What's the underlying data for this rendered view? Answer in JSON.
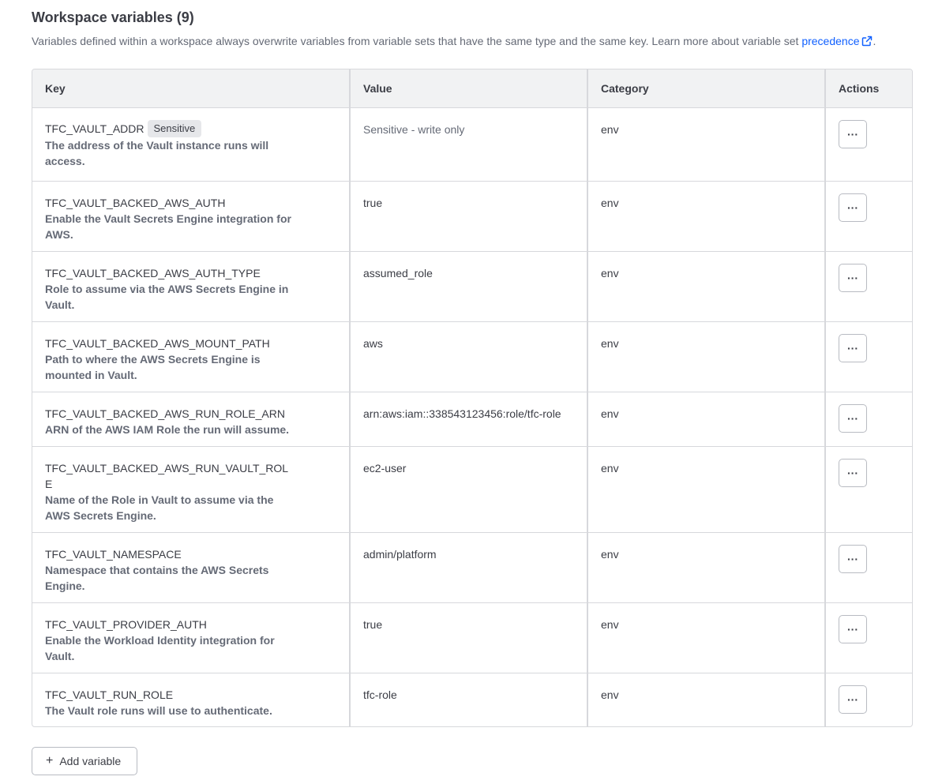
{
  "header": {
    "title": "Workspace variables (9)",
    "description": "Variables defined within a workspace always overwrite variables from variable sets that have the same type and the same key. Learn more about variable set ",
    "link_text": "precedence",
    "period": "."
  },
  "table": {
    "columns": [
      "Key",
      "Value",
      "Category",
      "Actions"
    ],
    "rows": [
      {
        "key": "TFC_VAULT_ADDR",
        "badge": "Sensitive",
        "description": "The address of the Vault instance runs will access.",
        "value": "Sensitive - write only",
        "category": "env",
        "actions": "···"
      },
      {
        "key": "TFC_VAULT_BACKED_AWS_AUTH",
        "description": "Enable the Vault Secrets Engine integration for AWS.",
        "value": "true",
        "category": "env",
        "actions": "···"
      },
      {
        "key": "TFC_VAULT_BACKED_AWS_AUTH_TYPE",
        "description": "Role to assume via the AWS Secrets Engine in Vault.",
        "value": "assumed_role",
        "category": "env",
        "actions": "···"
      },
      {
        "key": "TFC_VAULT_BACKED_AWS_MOUNT_PATH",
        "description": "Path to where the AWS Secrets Engine is mounted in Vault.",
        "value": "aws",
        "category": "env",
        "actions": "···"
      },
      {
        "key": "TFC_VAULT_BACKED_AWS_RUN_ROLE_ARN",
        "description": "ARN of the AWS IAM Role the run will assume.",
        "value": "arn:aws:iam::338543123456:role/tfc-role",
        "category": "env",
        "actions": "···"
      },
      {
        "key": "TFC_VAULT_BACKED_AWS_RUN_VAULT_ROLE",
        "description": "Name of the Role in Vault to assume via the AWS Secrets Engine.",
        "value": "ec2-user",
        "category": "env",
        "actions": "···"
      },
      {
        "key": "TFC_VAULT_NAMESPACE",
        "description": "Namespace that contains the AWS Secrets Engine.",
        "value": "admin/platform",
        "category": "env",
        "actions": "···"
      },
      {
        "key": "TFC_VAULT_PROVIDER_AUTH",
        "description": "Enable the Workload Identity integration for Vault.",
        "value": "true",
        "category": "env",
        "actions": "···"
      },
      {
        "key": "TFC_VAULT_RUN_ROLE",
        "description": "The Vault role runs will use to authenticate.",
        "value": "tfc-role",
        "category": "env",
        "actions": "···"
      }
    ]
  },
  "footer": {
    "add_label": "Add variable"
  },
  "icons": {
    "external_link": "external-link-icon",
    "add": "plus-icon",
    "actions": "more-horizontal-icon"
  },
  "colors": {
    "link": "#1060ff",
    "header_bg": "#f1f2f3",
    "border": "#d7d8dc",
    "badge_bg": "#e6e7ea"
  }
}
